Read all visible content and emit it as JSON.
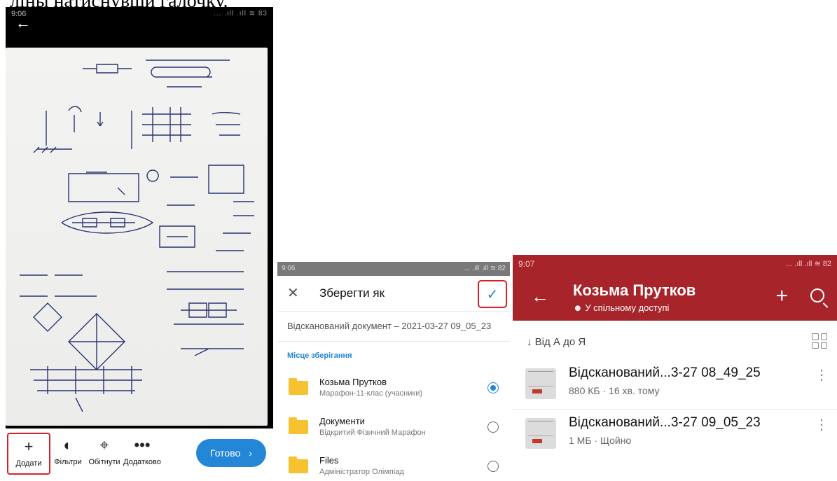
{
  "doc_text": "ліны натиснувши галочку.",
  "panel1": {
    "status_time": "9:06",
    "status_icons": "... .ıll .ıll ≋ 83",
    "toolbar": {
      "add": "Додати",
      "filters": "Фільтри",
      "crop": "Обітнути",
      "more": "Додатково",
      "done": "Готово"
    }
  },
  "panel2": {
    "status_time": "9:06",
    "status_icons": "... .ıll .ıll ≋ 82",
    "title": "Зберегти як",
    "filename": "Відсканований документ – 2021-03-27 09_05_23",
    "section": "Місце зберігання",
    "locations": [
      {
        "name": "Козьма Прутков",
        "sub": "Марафон-11-клас (учасники)",
        "selected": true
      },
      {
        "name": "Документи",
        "sub": "Відкритий Фізичний Марафон",
        "selected": false
      },
      {
        "name": "Files",
        "sub": "Адміністратор Олімпіад",
        "selected": false
      }
    ]
  },
  "panel3": {
    "status_time": "9:07",
    "status_icons": "... .ıll .ıll ≋ 82",
    "title": "Козьма Прутков",
    "shared": "У спільному доступі",
    "sort": "Від А до Я",
    "files": [
      {
        "name": "Відсканований...3-27 08_49_25",
        "meta": "880 КБ · 16 хв. тому"
      },
      {
        "name": "Відсканований...3-27 09_05_23",
        "meta": "1 МБ · Щойно"
      }
    ]
  },
  "colors": {
    "accent_blue": "#2486d6",
    "header_red": "#a8242b",
    "highlight": "#d6212d"
  }
}
